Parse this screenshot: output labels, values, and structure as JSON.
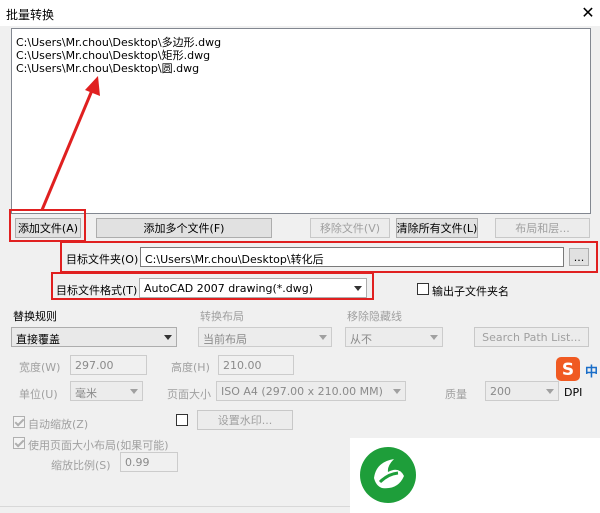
{
  "window": {
    "title": "批量转换",
    "close_glyph": "✕"
  },
  "file_list": [
    "C:\\Users\\Mr.chou\\Desktop\\多边形.dwg",
    "C:\\Users\\Mr.chou\\Desktop\\矩形.dwg",
    "C:\\Users\\Mr.chou\\Desktop\\圆.dwg"
  ],
  "buttons": {
    "add_file": "添加文件(A)",
    "add_multiple": "添加多个文件(F)",
    "remove_file": "移除文件(V)",
    "clear_all": "清除所有文件(L)",
    "layout_layers": "布局和层...",
    "browse": "...",
    "search_path": "Search Path List...",
    "watermark": "设置水印..."
  },
  "target_folder": {
    "label": "目标文件夹(O)",
    "value": "C:\\Users\\Mr.chou\\Desktop\\转化后"
  },
  "target_format": {
    "label": "目标文件格式(T)",
    "value": "AutoCAD 2007 drawing(*.dwg)"
  },
  "output_subfolder": {
    "label": "输出子文件夹名",
    "checked": false
  },
  "replace_rule": {
    "label": "替换规则",
    "value": "直接覆盖"
  },
  "convert_layout": {
    "label": "转换布局",
    "value": "当前布局"
  },
  "remove_hidden": {
    "label": "移除隐藏线",
    "value": "从不"
  },
  "width": {
    "label": "宽度(W)",
    "value": "297.00"
  },
  "height": {
    "label": "高度(H)",
    "value": "210.00"
  },
  "unit": {
    "label": "单位(U)",
    "value": "毫米"
  },
  "page_size": {
    "label": "页面大小",
    "value": "ISO A4 (297.00 x 210.00 MM)"
  },
  "quality": {
    "label": "质量",
    "value": "200",
    "unit": "DPI"
  },
  "auto_zoom": {
    "label": "自动缩放(Z)",
    "checked": true
  },
  "use_page_layout": {
    "label": "使用页面大小布局(如果可能)",
    "checked": true
  },
  "scale": {
    "label": "缩放比例(S)",
    "value": "0.99"
  },
  "ime_badge": {
    "text": "中"
  },
  "colors": {
    "annotation_red": "#e02020",
    "logo_green": "#1e9e3a"
  }
}
